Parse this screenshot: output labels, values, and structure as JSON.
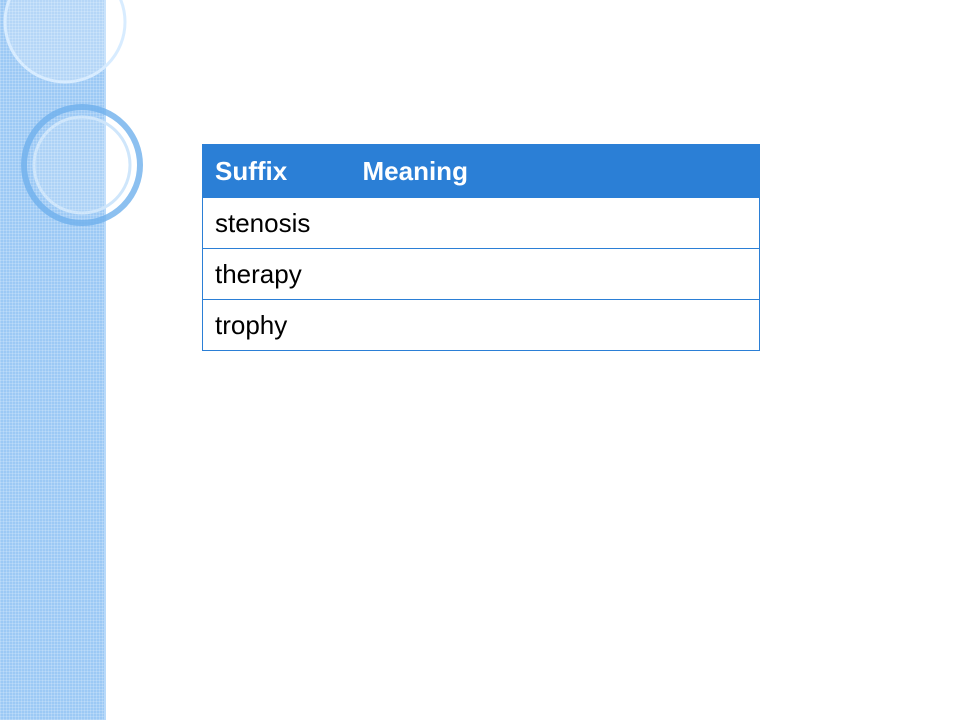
{
  "table": {
    "headers": [
      "Suffix",
      "Meaning"
    ],
    "rows": [
      {
        "suffix": "stenosis",
        "meaning": ""
      },
      {
        "suffix": "therapy",
        "meaning": ""
      },
      {
        "suffix": "trophy",
        "meaning": ""
      }
    ]
  },
  "colors": {
    "header_bg": "#2b7fd6",
    "side_band": "#9cc9f5",
    "border": "#2b7fd6"
  }
}
